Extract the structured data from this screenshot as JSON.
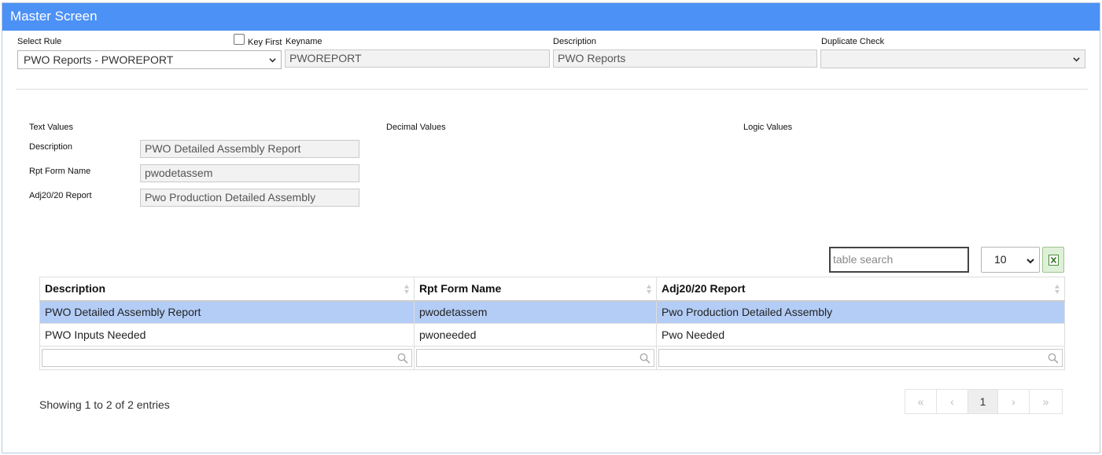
{
  "window": {
    "title": "Master Screen"
  },
  "header": {
    "select_rule": {
      "label": "Select Rule",
      "value": "PWO Reports - PWOREPORT"
    },
    "key_first": {
      "label": "Key First",
      "checked": false
    },
    "keyname": {
      "label": "Keyname",
      "value": "PWOREPORT"
    },
    "description": {
      "label": "Description",
      "value": "PWO Reports"
    },
    "duplicate_check": {
      "label": "Duplicate Check",
      "value": ""
    }
  },
  "values": {
    "text_heading": "Text Values",
    "decimal_heading": "Decimal Values",
    "logic_heading": "Logic Values",
    "fields": [
      {
        "label": "Description",
        "value": "PWO Detailed Assembly Report"
      },
      {
        "label": "Rpt Form Name",
        "value": "pwodetassem"
      },
      {
        "label": "Adj20/20 Report",
        "value": "Pwo Production Detailed Assembly"
      }
    ]
  },
  "table": {
    "search_placeholder": "table search",
    "page_size": "10",
    "columns": [
      "Description",
      "Rpt Form Name",
      "Adj20/20 Report"
    ],
    "rows": [
      [
        "PWO Detailed Assembly Report",
        "pwodetassem",
        "Pwo Production Detailed Assembly"
      ],
      [
        "PWO Inputs Needed",
        "pwoneeded",
        "Pwo Needed"
      ]
    ],
    "info": "Showing 1 to 2 of 2 entries",
    "pager": {
      "first": "«",
      "prev": "‹",
      "current": "1",
      "next": "›",
      "last": "»"
    }
  },
  "colors": {
    "titlebar": "#4c91f5",
    "selected_row": "#b3cdf6",
    "excel_button": "#dff0d8"
  },
  "icons": [
    "chevron-down-icon",
    "sort-icon",
    "search-icon",
    "excel-icon"
  ]
}
